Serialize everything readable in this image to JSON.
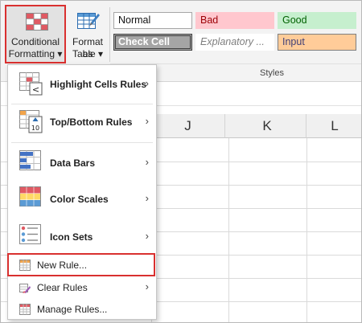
{
  "ribbon": {
    "conditional_formatting": {
      "line1": "Conditional",
      "line2": "Formatting ▾"
    },
    "format_as_table": {
      "line1": "Format as",
      "line2": "Table ▾"
    },
    "styles": {
      "normal": "Normal",
      "bad": "Bad",
      "good": "Good",
      "check_cell": "Check Cell",
      "explanatory": "Explanatory ...",
      "input": "Input"
    },
    "styles_group_label": "Styles"
  },
  "sheet": {
    "columns": [
      "J",
      "K",
      "L"
    ]
  },
  "menu": {
    "items": [
      {
        "label": "Highlight Cells Rules",
        "icon": "highlight-cells-icon"
      },
      {
        "label": "Top/Bottom Rules",
        "icon": "top-bottom-icon"
      },
      {
        "label": "Data Bars",
        "icon": "data-bars-icon"
      },
      {
        "label": "Color Scales",
        "icon": "color-scales-icon"
      },
      {
        "label": "Icon Sets",
        "icon": "icon-sets-icon"
      },
      {
        "label": "New Rule...",
        "icon": "new-rule-icon"
      },
      {
        "label": "Clear Rules",
        "icon": "clear-rules-icon"
      },
      {
        "label": "Manage Rules...",
        "icon": "manage-rules-icon"
      }
    ]
  },
  "colors": {
    "highlight": "#d9302f",
    "bad_fill": "#ffc7ce",
    "good_fill": "#c6efce",
    "input_fill": "#ffcc99"
  }
}
